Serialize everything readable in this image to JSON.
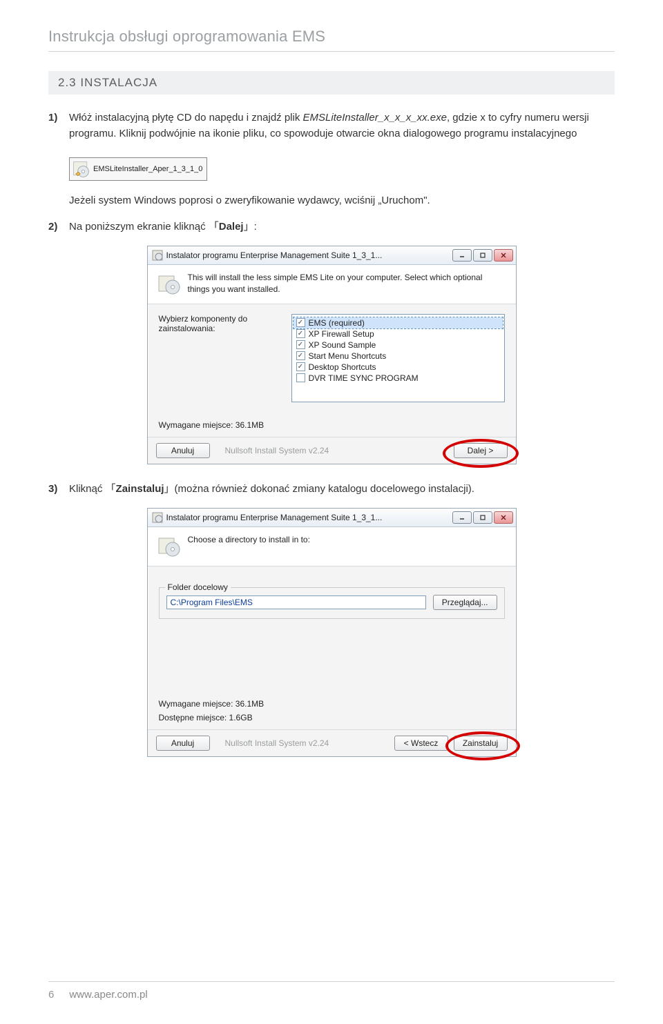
{
  "doc": {
    "header": "Instrukcja obsługi oprogramowania EMS",
    "section": "2.3  INSTALACJA",
    "page_number": "6",
    "site": "www.aper.com.pl"
  },
  "steps": {
    "s1_num": "1)",
    "s1_text_a": "Włóż instalacyjną płytę CD do napędu i znajdź plik ",
    "s1_file": "EMSLiteInstaller_x_x_x_xx.exe",
    "s1_text_b": ", gdzie x to cyfry numeru wersji programu. Kliknij podwójnie na ikonie pliku, co spowoduje otwarcie okna dialogowego programu instalacyjnego",
    "installer_icon_label": "EMSLiteInstaller_Aper_1_3_1_0",
    "s1_note": "Jeżeli system Windows poprosi o zweryfikowanie wydawcy, wciśnij „Uruchom\".",
    "s2_num": "2)",
    "s2_text_a": "Na poniższym ekranie kliknąć 「",
    "s2_bold": "Dalej",
    "s2_text_b": "」:",
    "s3_num": "3)",
    "s3_text_a": "Kliknąć 「",
    "s3_bold": "Zainstaluj",
    "s3_text_b": "」(można również dokonać zmiany katalogu docelowego instalacji)."
  },
  "dialog1": {
    "title": "Instalator programu Enterprise Management Suite 1_3_1...",
    "top_text": "This will install the less simple EMS Lite on your computer. Select which optional things you want installed.",
    "label_components": "Wybierz komponenty do zainstalowania:",
    "components": [
      {
        "label": "EMS (required)",
        "checked": true,
        "selected": true
      },
      {
        "label": "XP Firewall Setup",
        "checked": true,
        "selected": false
      },
      {
        "label": "XP Sound Sample",
        "checked": true,
        "selected": false
      },
      {
        "label": "Start Menu Shortcuts",
        "checked": true,
        "selected": false
      },
      {
        "label": "Desktop Shortcuts",
        "checked": true,
        "selected": false
      },
      {
        "label": "DVR TIME SYNC PROGRAM",
        "checked": false,
        "selected": false
      }
    ],
    "req_space": "Wymagane miejsce: 36.1MB",
    "btn_cancel": "Anuluj",
    "nsis": "Nullsoft Install System v2.24",
    "btn_next": "Dalej >"
  },
  "dialog2": {
    "title": "Instalator programu Enterprise Management Suite 1_3_1...",
    "top_text": "Choose a directory to install in to:",
    "group_legend": "Folder docelowy",
    "path": "C:\\Program Files\\EMS",
    "btn_browse": "Przeglądaj...",
    "req_space": "Wymagane miejsce: 36.1MB",
    "avail_space": "Dostępne miejsce: 1.6GB",
    "btn_cancel": "Anuluj",
    "nsis": "Nullsoft Install System v2.24",
    "btn_back": "< Wstecz",
    "btn_install": "Zainstaluj"
  }
}
